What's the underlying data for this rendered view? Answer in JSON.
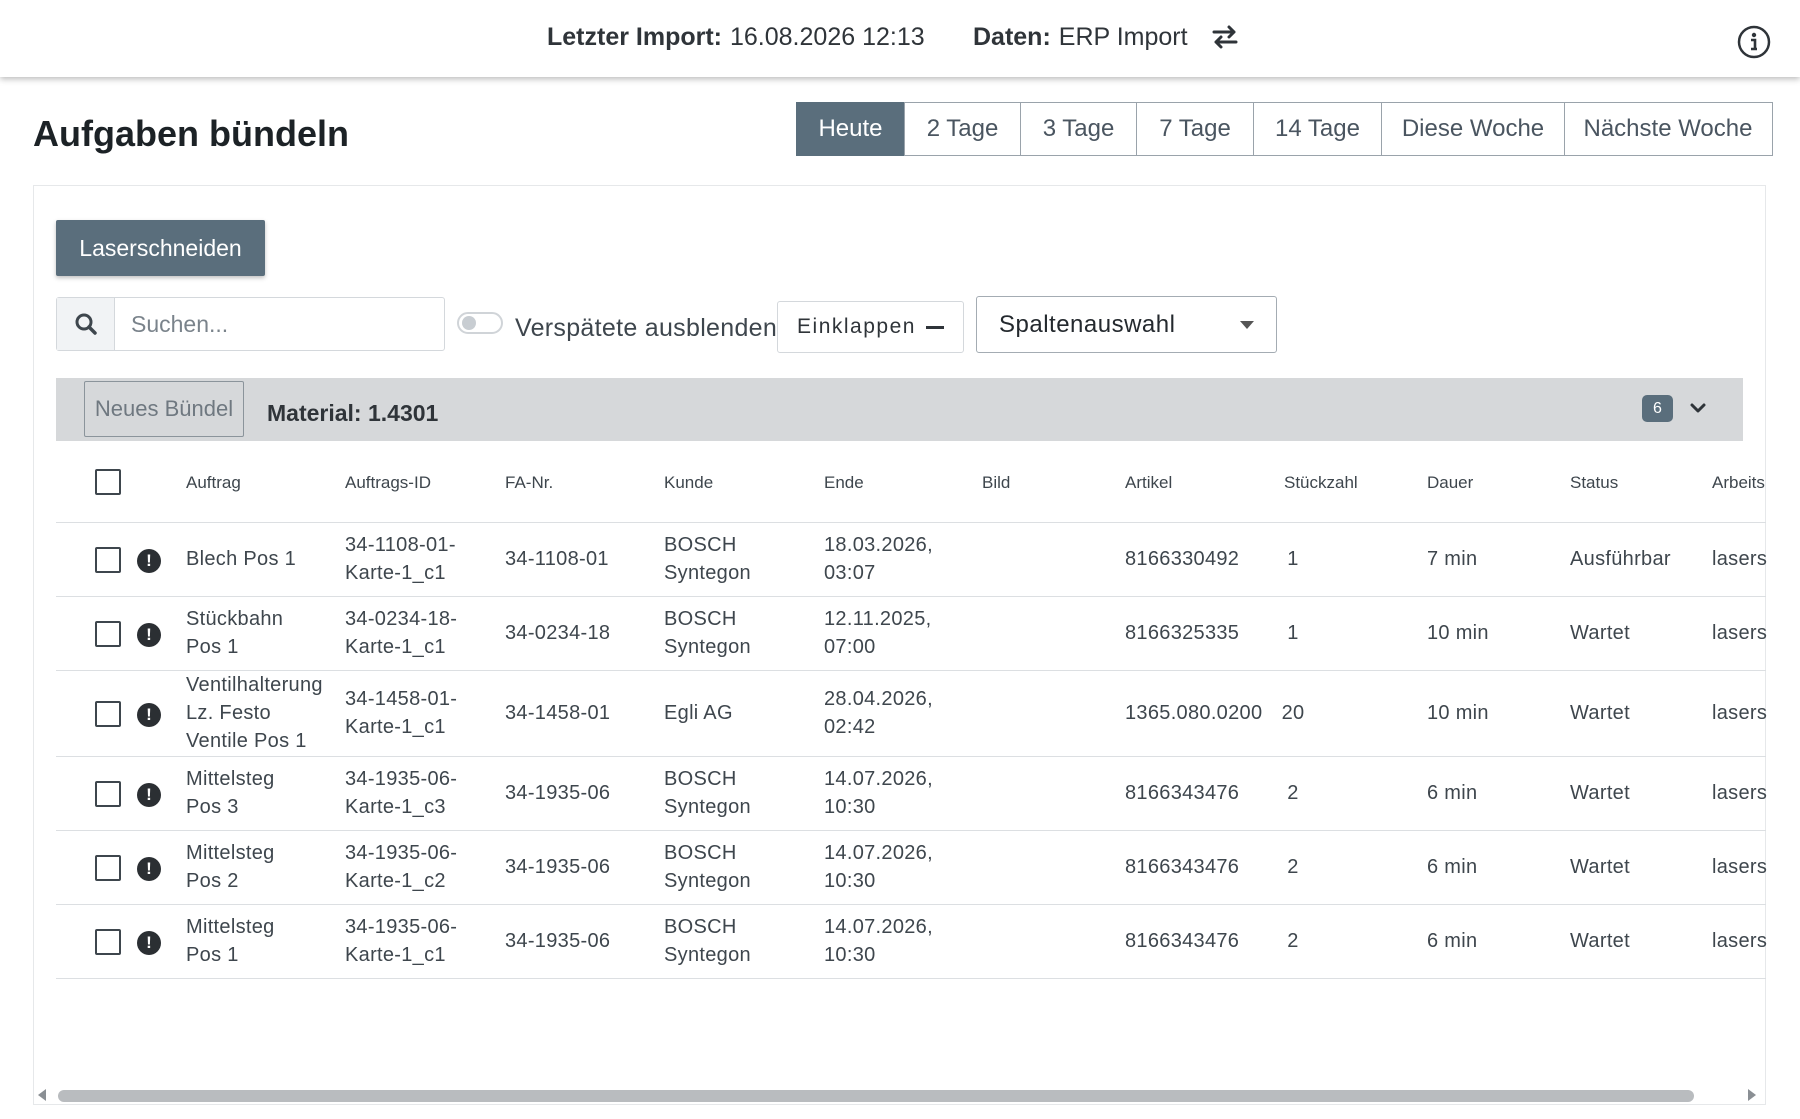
{
  "header": {
    "import_label": "Letzter Import:",
    "import_value": "16.08.2026 12:13",
    "data_label": "Daten:",
    "data_value": "ERP Import",
    "swap_icon": "swap-arrows-icon",
    "info_icon": "info-icon"
  },
  "page": {
    "title": "Aufgaben bündeln"
  },
  "tabs": [
    {
      "label": "Heute",
      "active": true
    },
    {
      "label": "2 Tage",
      "active": false
    },
    {
      "label": "3 Tage",
      "active": false
    },
    {
      "label": "7 Tage",
      "active": false
    },
    {
      "label": "14 Tage",
      "active": false
    },
    {
      "label": "Diese Woche",
      "active": false
    },
    {
      "label": "Nächste Woche",
      "active": false
    }
  ],
  "toolbar": {
    "process_button": "Laserschneiden",
    "search_placeholder": "Suchen...",
    "toggle_label": "Verspätete ausblenden",
    "toggle_on": false,
    "collapse_label": "Einklappen",
    "column_select_label": "Spaltenauswahl"
  },
  "group": {
    "new_bundle_label": "Neues Bündel",
    "material_label": "Material: 1.4301",
    "count": "6"
  },
  "columns": [
    "Auftrag",
    "Auftrags-ID",
    "FA-Nr.",
    "Kunde",
    "Ende",
    "Bild",
    "Artikel",
    "Stückzahl",
    "Dauer",
    "Status",
    "Arbeits"
  ],
  "rows": [
    {
      "auftrag": [
        "Blech Pos 1"
      ],
      "auftrags_id": [
        "34-1108-01-",
        "Karte-1_c1"
      ],
      "fa_nr": "34-1108-01",
      "kunde": [
        "BOSCH",
        "Syntegon"
      ],
      "ende": [
        "18.03.2026,",
        "03:07"
      ],
      "artikel": "8166330492",
      "stueckzahl": "1",
      "dauer": "7 min",
      "status": "Ausführbar",
      "arbeits": "lasers"
    },
    {
      "auftrag": [
        "Stückbahn",
        "Pos 1"
      ],
      "auftrags_id": [
        "34-0234-18-",
        "Karte-1_c1"
      ],
      "fa_nr": "34-0234-18",
      "kunde": [
        "BOSCH",
        "Syntegon"
      ],
      "ende": [
        "12.11.2025,",
        "07:00"
      ],
      "artikel": "8166325335",
      "stueckzahl": "1",
      "dauer": "10 min",
      "status": "Wartet",
      "arbeits": "lasers"
    },
    {
      "auftrag": [
        "Ventilhalterung",
        "Lz. Festo",
        "Ventile Pos 1"
      ],
      "auftrags_id": [
        "34-1458-01-",
        "Karte-1_c1"
      ],
      "fa_nr": "34-1458-01",
      "kunde": [
        "Egli AG"
      ],
      "ende": [
        "28.04.2026,",
        "02:42"
      ],
      "artikel": "1365.080.0200",
      "stueckzahl": "20",
      "dauer": "10 min",
      "status": "Wartet",
      "arbeits": "lasers"
    },
    {
      "auftrag": [
        "Mittelsteg",
        "Pos 3"
      ],
      "auftrags_id": [
        "34-1935-06-",
        "Karte-1_c3"
      ],
      "fa_nr": "34-1935-06",
      "kunde": [
        "BOSCH",
        "Syntegon"
      ],
      "ende": [
        "14.07.2026,",
        "10:30"
      ],
      "artikel": "8166343476",
      "stueckzahl": "2",
      "dauer": "6 min",
      "status": "Wartet",
      "arbeits": "lasers"
    },
    {
      "auftrag": [
        "Mittelsteg",
        "Pos 2"
      ],
      "auftrags_id": [
        "34-1935-06-",
        "Karte-1_c2"
      ],
      "fa_nr": "34-1935-06",
      "kunde": [
        "BOSCH",
        "Syntegon"
      ],
      "ende": [
        "14.07.2026,",
        "10:30"
      ],
      "artikel": "8166343476",
      "stueckzahl": "2",
      "dauer": "6 min",
      "status": "Wartet",
      "arbeits": "lasers"
    },
    {
      "auftrag": [
        "Mittelsteg",
        "Pos 1"
      ],
      "auftrags_id": [
        "34-1935-06-",
        "Karte-1_c1"
      ],
      "fa_nr": "34-1935-06",
      "kunde": [
        "BOSCH",
        "Syntegon"
      ],
      "ende": [
        "14.07.2026,",
        "10:30"
      ],
      "artikel": "8166343476",
      "stueckzahl": "2",
      "dauer": "6 min",
      "status": "Wartet",
      "arbeits": "lasers"
    }
  ],
  "colors": {
    "accent": "#5a6e7c",
    "group_bg": "#d6d8da"
  }
}
